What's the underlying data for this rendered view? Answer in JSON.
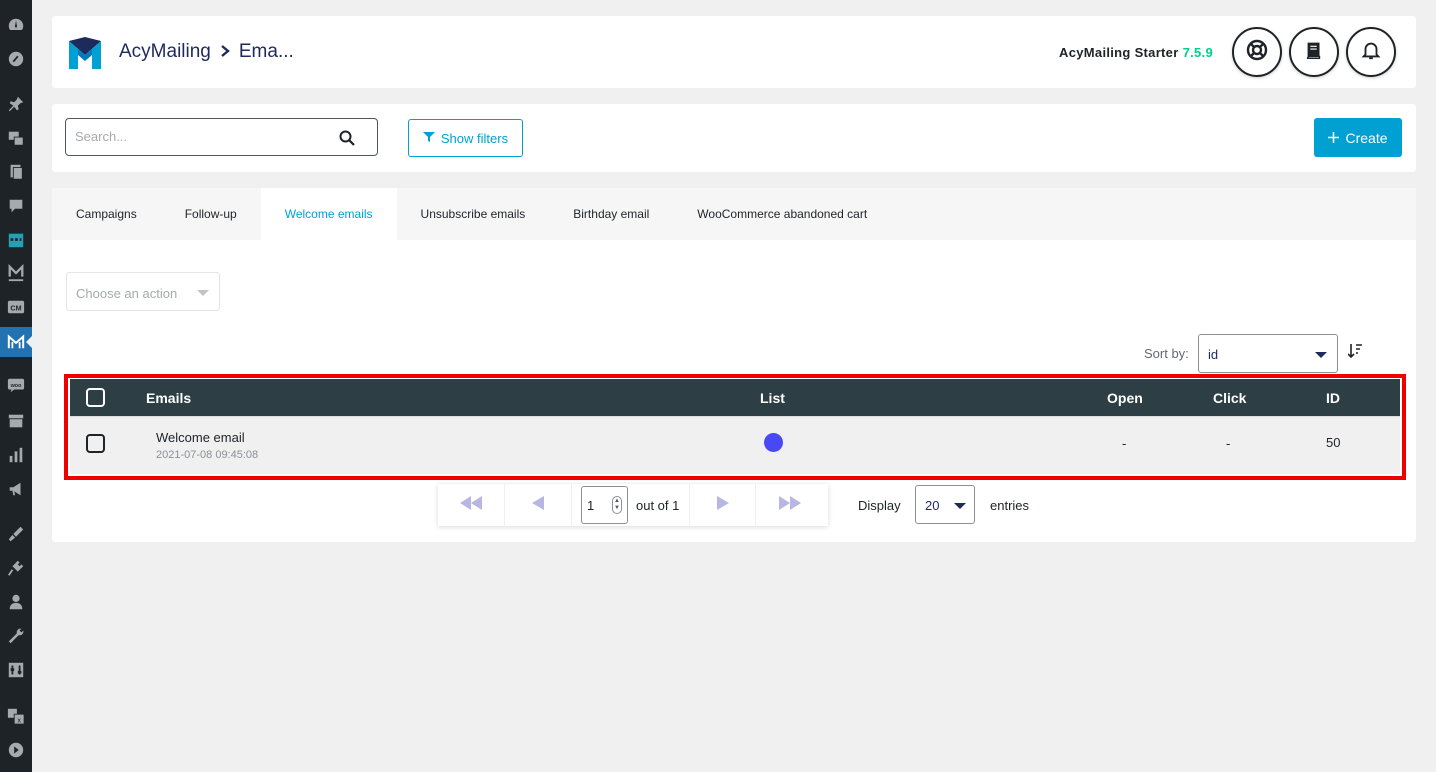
{
  "header": {
    "app_name": "AcyMailing",
    "current_page": "Ema...",
    "edition_label": "AcyMailing Starter",
    "version": "7.5.9",
    "colors": {
      "brand_blue": "#00a0d2",
      "version_green": "#00d088",
      "breadcrumb": "#1d2a5c"
    }
  },
  "toolbar": {
    "search_placeholder": "Search...",
    "show_filters_label": "Show filters",
    "create_label": "Create"
  },
  "tabs": [
    {
      "label": "Campaigns",
      "active": false
    },
    {
      "label": "Follow-up",
      "active": false
    },
    {
      "label": "Welcome emails",
      "active": true
    },
    {
      "label": "Unsubscribe emails",
      "active": false
    },
    {
      "label": "Birthday email",
      "active": false
    },
    {
      "label": "WooCommerce abandoned cart",
      "active": false
    }
  ],
  "actions": {
    "placeholder": "Choose an action"
  },
  "sort": {
    "label": "Sort by:",
    "value": "id"
  },
  "table": {
    "columns": {
      "emails": "Emails",
      "list": "List",
      "open": "Open",
      "click": "Click",
      "id": "ID"
    },
    "rows": [
      {
        "name": "Welcome email",
        "date": "2021-07-08 09:45:08",
        "list_color": "#4848f5",
        "open": "-",
        "click": "-",
        "id": "50"
      }
    ]
  },
  "pagination": {
    "page": "1",
    "out_of": "out of 1",
    "display_label": "Display",
    "per_page": "20",
    "entries_label": "entries"
  }
}
